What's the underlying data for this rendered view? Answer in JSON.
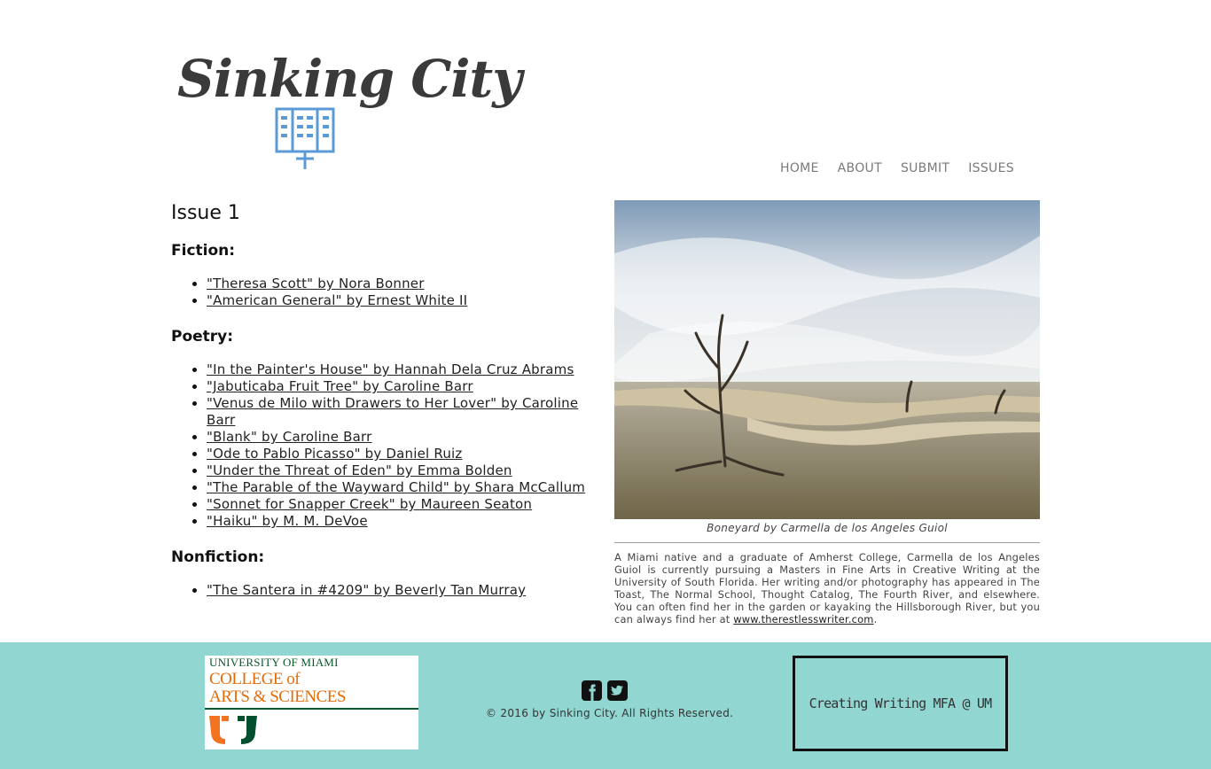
{
  "site": {
    "logo_text": "Sinking City"
  },
  "nav": [
    {
      "label": "HOME"
    },
    {
      "label": "ABOUT"
    },
    {
      "label": "SUBMIT"
    },
    {
      "label": "ISSUES"
    }
  ],
  "issue": {
    "title": "Issue 1",
    "sections": {
      "fiction": {
        "title": "Fiction:",
        "items": [
          "\"Theresa Scott\" by Nora Bonner",
          "\"American General\" by Ernest White II"
        ]
      },
      "poetry": {
        "title": "Poetry:",
        "items": [
          "\"In the Painter's House\" by Hannah Dela Cruz Abrams",
          "\"Jabuticaba Fruit Tree\" by Caroline Barr",
          "\"Venus de Milo with Drawers to Her Lover\" by Caroline Barr",
          "\"Blank\" by Caroline Barr",
          "\"Ode to Pablo Picasso\" by Daniel Ruiz",
          "\"Under the Threat of Eden\" by Emma Bolden",
          "\"The Parable of the Wayward Child\" by Shara McCallum",
          "\"Sonnet for Snapper Creek\" by Maureen Seaton",
          "\"Haiku\" by M. M. DeVoe"
        ]
      },
      "nonfiction": {
        "title": "Nonfiction:",
        "items": [
          "\"The Santera in #4209\" by Beverly Tan Murray"
        ]
      }
    }
  },
  "feature": {
    "caption": "Boneyard by Carmella de los Angeles Guiol",
    "bio_text": "A Miami native and a graduate of Amherst College, Carmella de los Angeles Guiol is currently pursuing a Masters in Fine Arts in Creative Writing at the University of South Florida. Her writing and/or photography has appeared in The Toast, The Normal School, Thought Catalog, The Fourth River, and elsewhere. You can often find her in the garden or kayaking the Hillsborough River, but you can always find her at ",
    "bio_link": "www.therestlesswriter.com",
    "bio_end": "."
  },
  "footer": {
    "um_logo": {
      "line1": "UNIVERSITY OF MIAMI",
      "line2": "COLLEGE of",
      "line3": "ARTS & SCIENCES"
    },
    "social_icons": [
      "facebook-icon",
      "twitter-icon"
    ],
    "copyright": "© 2016 by Sinking City. All Rights Reserved.",
    "mfa_button": "Creating Writing MFA @ UM",
    "bg_color": "#91d6d1"
  }
}
